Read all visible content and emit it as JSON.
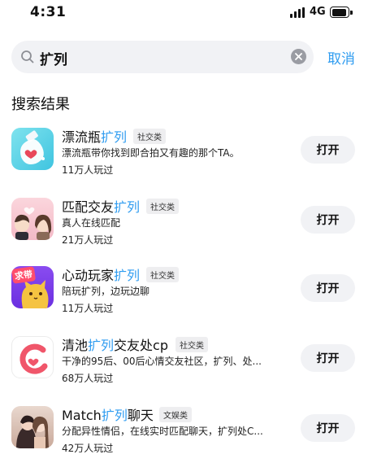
{
  "status_bar": {
    "time": "4:31",
    "network": "4G"
  },
  "search": {
    "query": "扩列",
    "cancel_label": "取消"
  },
  "section_title": "搜索结果",
  "results": [
    {
      "name_prefix": "漂流瓶",
      "name_highlight": "扩列",
      "name_suffix": "",
      "tag": "社交类",
      "desc": "漂流瓶带你找到即合拍又有趣的那个TA。",
      "plays": "11万人玩过",
      "open_label": "打开",
      "icon": "bottle-heart-icon"
    },
    {
      "name_prefix": "匹配交友",
      "name_highlight": "扩列",
      "name_suffix": "",
      "tag": "社交类",
      "desc": "真人在线匹配",
      "plays": "21万人玩过",
      "open_label": "打开",
      "icon": "couple-cartoon-icon"
    },
    {
      "name_prefix": "心动玩家",
      "name_highlight": "扩列",
      "name_suffix": "",
      "tag": "社交类",
      "desc": "陪玩扩列，边玩边聊",
      "plays": "11万人玩过",
      "open_label": "打开",
      "icon": "cat-carry-icon",
      "icon_badge": "求带"
    },
    {
      "name_prefix": "清池",
      "name_highlight": "扩列",
      "name_suffix": "交友处cp",
      "tag": "社交类",
      "desc": "干净的95后、00后心情交友社区，扩列、处...",
      "plays": "68万人玩过",
      "open_label": "打开",
      "icon": "qingchi-logo-icon"
    },
    {
      "name_prefix": "Match",
      "name_highlight": "扩列",
      "name_suffix": "聊天",
      "tag": "文娱类",
      "desc": "分配异性情侣，在线实时匹配聊天，扩列处C...",
      "plays": "42万人玩过",
      "open_label": "打开",
      "icon": "couple-photo-icon"
    }
  ],
  "colors": {
    "accent": "#2f9cf0",
    "button_bg": "#f1f2f5",
    "tag_bg": "#eeeef0"
  }
}
